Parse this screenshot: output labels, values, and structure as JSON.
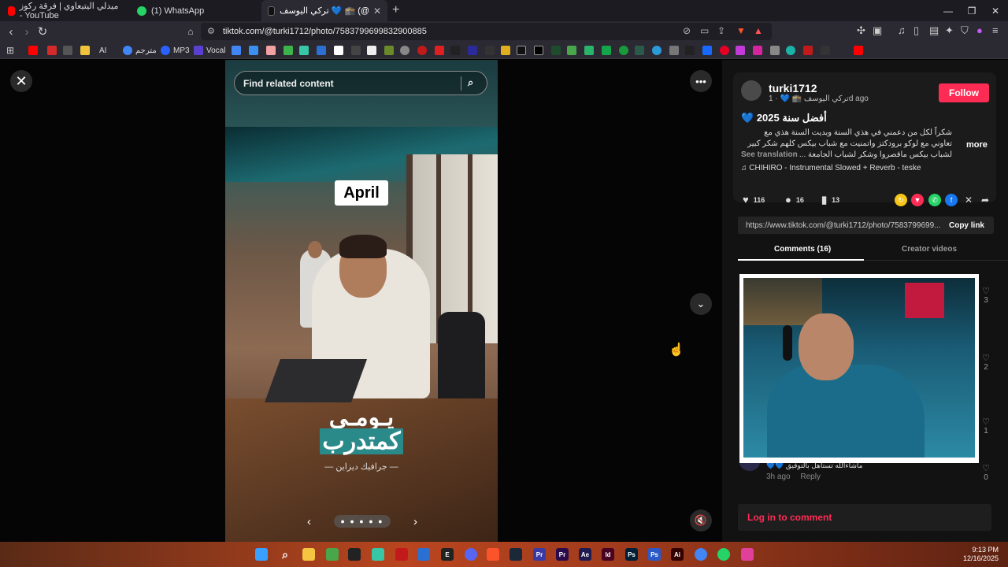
{
  "browser": {
    "tabs": [
      {
        "label": "ميدلي اليتيعاوي | فرقة ركوز - YouTube",
        "color": "#ff0000"
      },
      {
        "label": "(1) WhatsApp",
        "color": "#25d366"
      },
      {
        "label": "تركي اليوسف 💙 🕋 (@turki1712",
        "color": "#111111"
      }
    ],
    "url": "tiktok.com/@turki1712/photo/7583799699832900885",
    "bookmarks": [
      {
        "label": "",
        "color": "#ff0000"
      },
      {
        "label": "",
        "color": "#d52a2a"
      },
      {
        "label": "",
        "color": "#555555"
      },
      {
        "label": "",
        "color": "#f0c33c"
      },
      {
        "label": "AI",
        "color": "#000000"
      },
      {
        "label": "مترجم",
        "color": "#4285f4"
      },
      {
        "label": "MP3",
        "color": "#2962ff"
      },
      {
        "label": "Vocal",
        "color": "#5a3fd0"
      }
    ]
  },
  "stage": {
    "search_placeholder": "Find related content",
    "april_label": "April",
    "arabic_title_line1": "يـومـي",
    "arabic_title_line2": "كمتدرب",
    "arabic_sub": "— جرافيك ديزاين —",
    "carousel_dots": "● ● ● ● ●"
  },
  "post": {
    "username": "turki1712",
    "display": "تركي اليوسف 🕋 💙 · 1d ago",
    "follow_label": "Follow",
    "title": "💙 أفضل سنة 2025",
    "description": "شكراً لكل من دعمني في هذي السنة وبديت السنة هذي مع تعاوني مع لوكو برودكتز واتمنيت مع شباب بيكس كلهم شكر كبير لشباب بيكس ماقصروا وشكر لشباب الجامعة ...",
    "more_label": "more",
    "see_translation": "See translation",
    "music": "CHIHIRO - Instrumental Slowed + Reverb - teske",
    "likes": "116",
    "comments": "16",
    "saves": "13",
    "link": "https://www.tiktok.com/@turki1712/photo/7583799699...",
    "copy_label": "Copy link",
    "tab_comments": "Comments (16)",
    "tab_creator": "Creator videos",
    "comment_likes": [
      "3",
      "2",
      "1",
      "0"
    ],
    "comment_text": "ماشاءالله تستاهل بالتوفيق 💙💙",
    "comment_time": "3h ago",
    "reply_label": "Reply",
    "login_label": "Log in to comment"
  },
  "clock": {
    "time": "9:13 PM",
    "date": "12/16/2025"
  },
  "colors": {
    "accent": "#fe2c55"
  }
}
